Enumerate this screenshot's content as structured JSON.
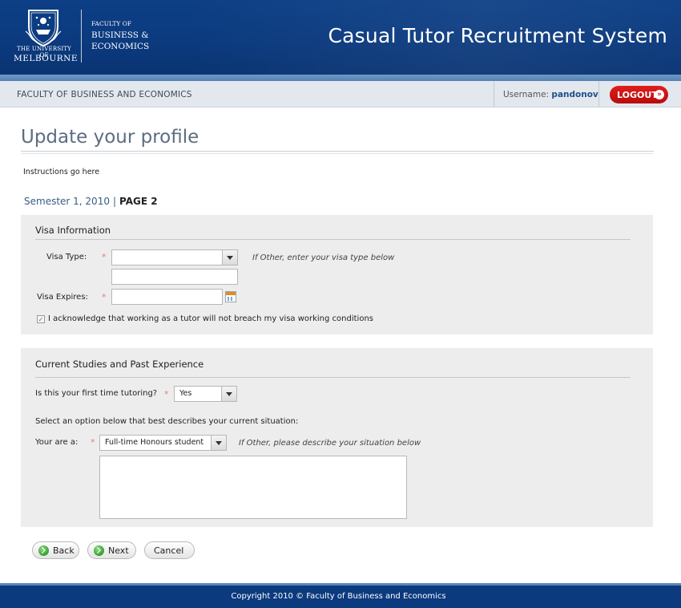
{
  "header": {
    "university_small": "THE UNIVERSITY OF",
    "university_big": "MELBOURNE",
    "faculty_of": "FACULTY OF",
    "faculty_name": "BUSINESS &\nECONOMICS",
    "app_title": "Casual Tutor Recruitment System",
    "brand_color": "#0b3a7e"
  },
  "subbar": {
    "faculty_label": "FACULTY OF BUSINESS AND ECONOMICS",
    "username_label": "Username:",
    "username": "pandonov",
    "logout_label": "LOGOUT",
    "logout_color": "#c51313"
  },
  "page": {
    "title": "Update your profile",
    "instructions": "Instructions go here",
    "semester": "Semester 1, 2010",
    "separator": "|",
    "page_label": "PAGE 2"
  },
  "visa": {
    "section_title": "Visa Information",
    "visa_type_label": "Visa Type:",
    "visa_type_value": "",
    "visa_type_hint": "If Other, enter your visa type below",
    "visa_other_value": "",
    "visa_expires_label": "Visa Expires:",
    "visa_expires_value": "",
    "acknowledge_label": "I acknowledge that working as a tutor will not breach my visa working conditions",
    "acknowledge_checked": true
  },
  "studies": {
    "section_title": "Current Studies and Past Experience",
    "first_time_label": "Is this your first time tutoring?",
    "first_time_value": "Yes",
    "select_prompt": "Select an option below that best describes your current situation:",
    "you_are_label": "Your are a:",
    "you_are_value": "Full-time Honours student",
    "you_are_hint": "If Other, please describe your situation below",
    "situation_text": ""
  },
  "required_marker": "*",
  "buttons": {
    "back": "Back",
    "next": "Next",
    "cancel": "Cancel"
  },
  "footer": {
    "copyright": "Copyright 2010 © Faculty of Business and Economics"
  }
}
